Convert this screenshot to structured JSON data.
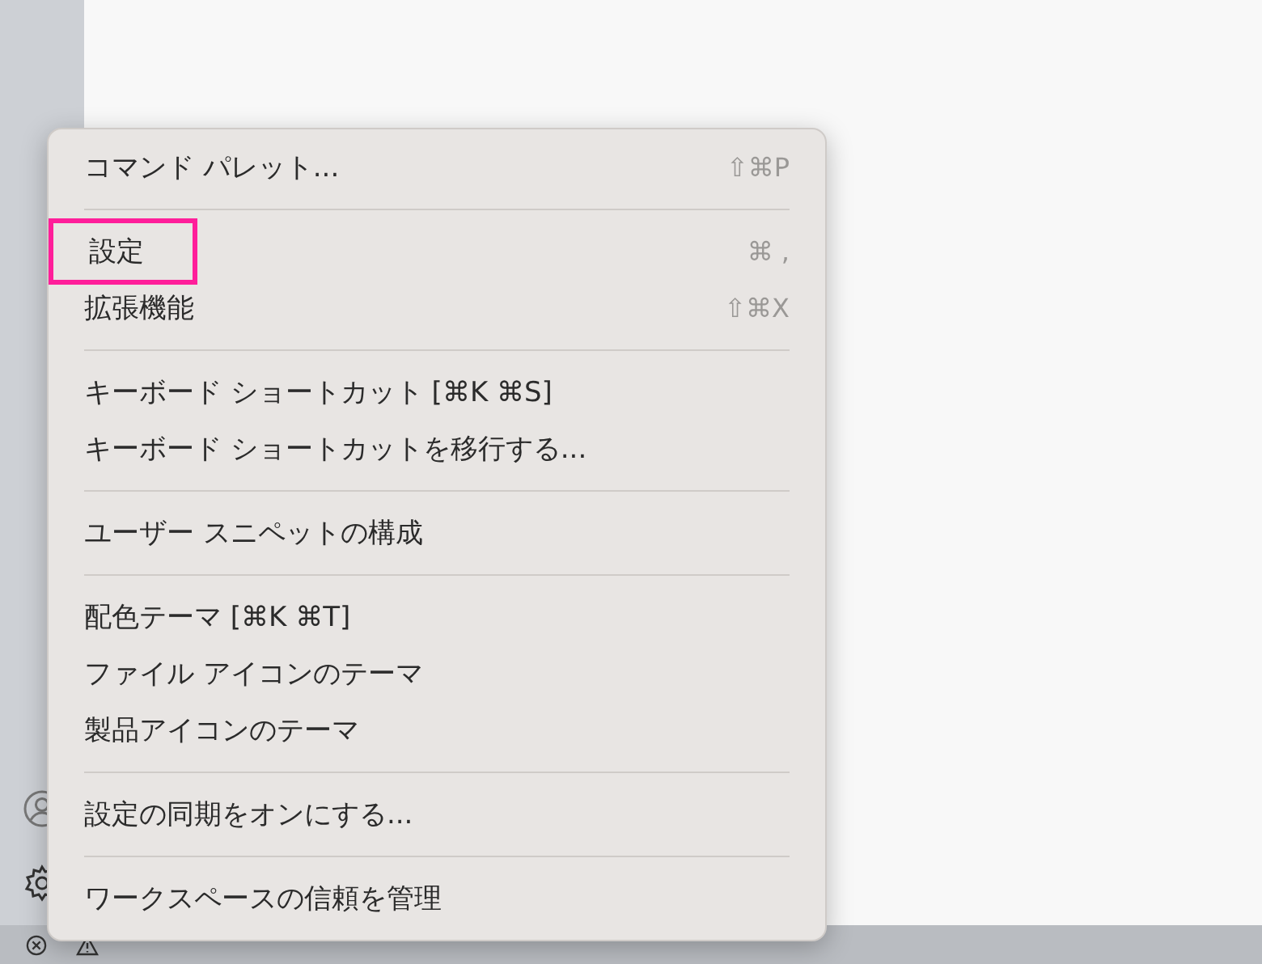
{
  "menu": {
    "groups": [
      {
        "items": [
          {
            "label": "コマンド パレット...",
            "shortcut": "⇧⌘P",
            "highlighted": false
          }
        ]
      },
      {
        "items": [
          {
            "label": "設定",
            "shortcut": "⌘ ,",
            "highlighted": true
          },
          {
            "label": "拡張機能",
            "shortcut": "⇧⌘X",
            "highlighted": false
          }
        ]
      },
      {
        "items": [
          {
            "label": "キーボード ショートカット [⌘K ⌘S]",
            "highlighted": false
          },
          {
            "label": "キーボード ショートカットを移行する...",
            "highlighted": false
          }
        ]
      },
      {
        "items": [
          {
            "label": "ユーザー スニペットの構成",
            "highlighted": false
          }
        ]
      },
      {
        "items": [
          {
            "label": "配色テーマ [⌘K ⌘T]",
            "highlighted": false
          },
          {
            "label": "ファイル アイコンのテーマ",
            "highlighted": false
          },
          {
            "label": "製品アイコンのテーマ",
            "highlighted": false
          }
        ]
      },
      {
        "items": [
          {
            "label": "設定の同期をオンにする...",
            "highlighted": false
          }
        ]
      },
      {
        "items": [
          {
            "label": "ワークスペースの信頼を管理",
            "highlighted": false
          }
        ]
      }
    ]
  }
}
